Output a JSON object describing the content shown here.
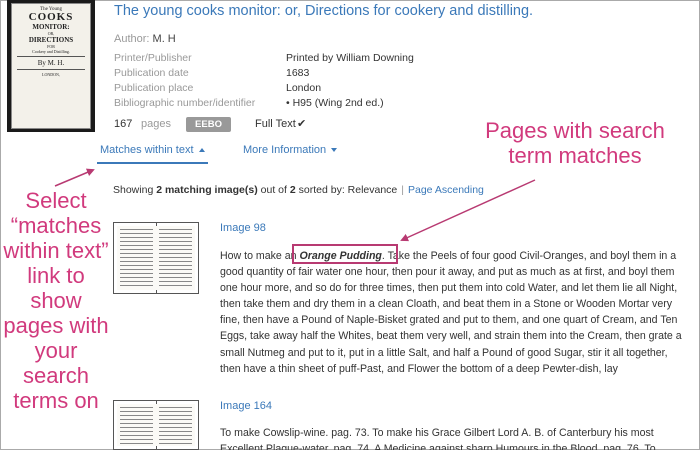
{
  "record": {
    "title": "The young cooks monitor: or, Directions for cookery and distilling.",
    "author_label": "Author:",
    "author": "M. H",
    "metadata": [
      {
        "label": "Printer/Publisher",
        "value": "Printed by William Downing"
      },
      {
        "label": "Publication date",
        "value": "1683"
      },
      {
        "label": "Publication place",
        "value": "London"
      },
      {
        "label": "Bibliographic number/identifier",
        "value": "• H95 (Wing 2nd ed.)"
      }
    ],
    "pages_count": "167",
    "pages_label": "pages",
    "source_badge": "EEBO",
    "fulltext_label": "Full Text",
    "fulltext_check": "✔"
  },
  "cover": {
    "line1": "The Young",
    "line2": "COOKS",
    "line3": "MONITOR:",
    "line4": "OR,",
    "line5": "DIRECTIONS",
    "line6": "FOR",
    "line7": "Cookery and Distilling.",
    "line8": "By M. H.",
    "line9": "LONDON,"
  },
  "tabs": [
    {
      "label": "Matches within text",
      "active": true
    },
    {
      "label": "More Information",
      "active": false
    }
  ],
  "results_summary": {
    "prefix": "Showing",
    "count": "2 matching image(s)",
    "mid": "out of",
    "total": "2",
    "sorted": "sorted by: Relevance",
    "sort_link": "Page Ascending"
  },
  "results": [
    {
      "image_label": "Image 98",
      "excerpt_before": "How to make an ",
      "excerpt_hit": "Orange Pudding",
      "excerpt_after": ". Take the Peels of four good Civil-Oranges, and boyl them in a good quantity of fair water one hour, then pour it away, and put as much as at first, and boyl them one hour more, and so do for three times, then put them into cold Water, and let them lie all Night, then take them and dry them in a clean Cloath, and beat them in a Stone or Wooden Mortar very fine, then have a Pound of Naple-Bisket grated and put to them, and one quart of Cream, and Ten Eggs, take away half the Whites, beat them very well, and strain them into the Cream, then grate a small Nutmeg and put to it, put in a little Salt, and half a Pound of good Sugar, stir it all together, then have a thin sheet of puff-Past, and Flower the bottom of a deep Pewter-dish, lay"
    },
    {
      "image_label": "Image 164",
      "excerpt": "To make Cowslip-wine. pag. 73. To make his Grace Gilbert Lord A. B. of Canterbury his most Excellent Plague-water. pag. 74. A Medicine against sharp Humours in the Blood. pag. 76. To"
    }
  ],
  "annotations": {
    "left": "Select “matches within text” link to show pages with your search terms on",
    "right": "Pages with search term matches"
  },
  "colors": {
    "link": "#3b79b9",
    "annotation": "#d13a7d",
    "badge": "#999999"
  }
}
